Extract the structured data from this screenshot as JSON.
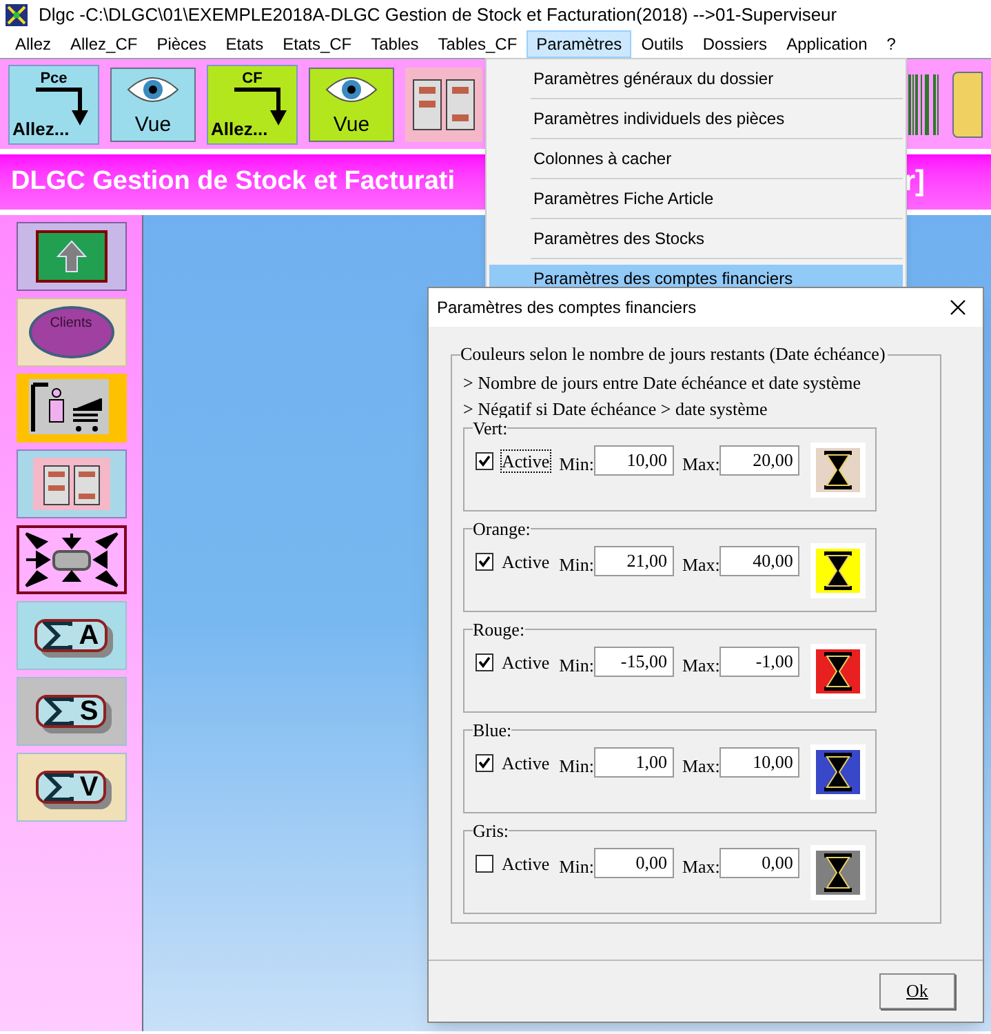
{
  "window": {
    "title": "Dlgc -C:\\DLGC\\01\\EXEMPLE2018A-DLGC Gestion de Stock et Facturation(2018) -->01-Superviseur"
  },
  "menu_bar": [
    {
      "label": "Allez",
      "selected": false
    },
    {
      "label": "Allez_CF",
      "selected": false
    },
    {
      "label": "Pièces",
      "selected": false
    },
    {
      "label": "Etats",
      "selected": false
    },
    {
      "label": "Etats_CF",
      "selected": false
    },
    {
      "label": "Tables",
      "selected": false
    },
    {
      "label": "Tables_CF",
      "selected": false
    },
    {
      "label": "Paramètres",
      "selected": true
    },
    {
      "label": "Outils",
      "selected": false
    },
    {
      "label": "Dossiers",
      "selected": false
    },
    {
      "label": "Application",
      "selected": false
    },
    {
      "label": "?",
      "selected": false
    }
  ],
  "toolbar": [
    {
      "kind": "goto",
      "caption": "Pce",
      "label": "Allez...",
      "color": "#9adcec"
    },
    {
      "kind": "view",
      "label": "Vue",
      "color": "#9adcec"
    },
    {
      "kind": "goto",
      "caption": "CF",
      "label": "Allez...",
      "color": "#b4e61e"
    },
    {
      "kind": "view",
      "label": "Vue",
      "color": "#b4e61e"
    },
    {
      "kind": "shelves"
    },
    {
      "kind": "barcode"
    },
    {
      "kind": "calendar"
    }
  ],
  "banner": {
    "title": "DLGC Gestion de Stock et Facturati",
    "tail": "r]"
  },
  "sidebar": {
    "items": [
      {
        "kind": "up"
      },
      {
        "kind": "clients",
        "label": "Clients"
      },
      {
        "kind": "person"
      },
      {
        "kind": "shelves"
      },
      {
        "kind": "arrows"
      },
      {
        "kind": "sigma",
        "label": "A",
        "color": "#a8dce8"
      },
      {
        "kind": "sigma",
        "label": "S",
        "color": "#c0c0c0"
      },
      {
        "kind": "sigma",
        "label": "V",
        "color": "#f0e0b8"
      }
    ]
  },
  "dropdown": {
    "items": [
      {
        "label": "Paramètres généraux du dossier",
        "selected": false
      },
      {
        "label": "Paramètres individuels des pièces",
        "selected": false
      },
      {
        "label": "Colonnes à cacher",
        "selected": false
      },
      {
        "label": "Paramètres Fiche Article",
        "selected": false
      },
      {
        "label": "Paramètres des Stocks",
        "selected": false
      },
      {
        "label": "Paramètres des comptes financiers",
        "selected": true
      }
    ]
  },
  "dialog": {
    "title": "Paramètres des comptes financiers",
    "legend": "Couleurs selon le nombre de jours restants (Date échéance)",
    "notes": [
      "> Nombre de jours entre Date échéance et date système",
      "> Négatif si Date échéance > date système"
    ],
    "groups": [
      {
        "label": "Vert:",
        "checked": true,
        "focused": true,
        "active_label": "Active",
        "min_label": "Min:",
        "min": "10,00",
        "max_label": "Max:",
        "max": "20,00",
        "color": "#e6d4c4"
      },
      {
        "label": "Orange:",
        "checked": true,
        "focused": false,
        "active_label": "Active",
        "min_label": "Min:",
        "min": "21,00",
        "max_label": "Max:",
        "max": "40,00",
        "color": "#ffff00"
      },
      {
        "label": "Rouge:",
        "checked": true,
        "focused": false,
        "active_label": "Active",
        "min_label": "Min:",
        "min": "-15,00",
        "max_label": "Max:",
        "max": "-1,00",
        "color": "#e82020"
      },
      {
        "label": "Blue:",
        "checked": true,
        "focused": false,
        "active_label": "Active",
        "min_label": "Min:",
        "min": "1,00",
        "max_label": "Max:",
        "max": "10,00",
        "color": "#3848c8"
      },
      {
        "label": "Gris:",
        "checked": false,
        "focused": false,
        "active_label": "Active",
        "min_label": "Min:",
        "min": "0,00",
        "max_label": "Max:",
        "max": "0,00",
        "color": "#808080"
      }
    ],
    "ok_button": "Ok"
  }
}
